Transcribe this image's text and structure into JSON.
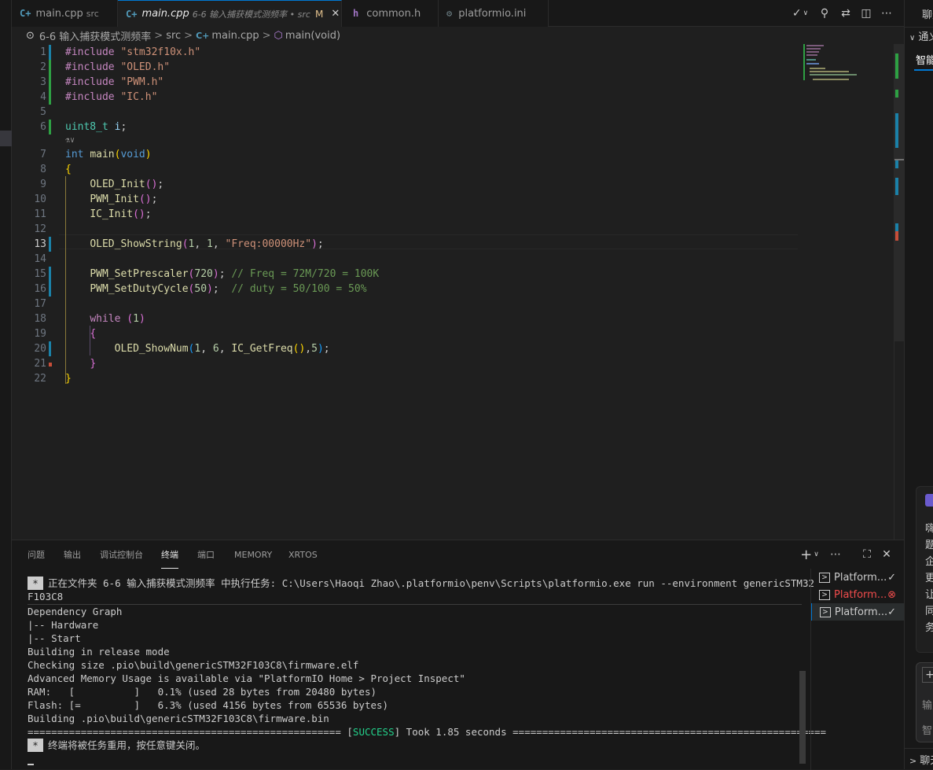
{
  "tabs": [
    {
      "icon": "C+",
      "label": "main.cpp",
      "dir": "src"
    },
    {
      "icon": "C+",
      "label": "main.cpp",
      "dir": "6-6 输入捕获模式测频率 • src",
      "status": "M",
      "close": "✕"
    },
    {
      "icon": "h",
      "label": "common.h"
    },
    {
      "icon": "⚙",
      "label": "platformio.ini"
    }
  ],
  "breadcrumb": {
    "folder": "6-6 输入捕获模式测频率",
    "src": "src",
    "file": "main.cpp",
    "symbol": "main(void)"
  },
  "code_lines": [
    {
      "n": "1",
      "tokens": [
        [
          "kwp",
          "#include"
        ],
        [
          "",
          " "
        ],
        [
          "str",
          "\"stm32f10x.h\""
        ]
      ]
    },
    {
      "n": "2",
      "tokens": [
        [
          "kwp",
          "#include"
        ],
        [
          "",
          " "
        ],
        [
          "str",
          "\"OLED.h\""
        ]
      ]
    },
    {
      "n": "3",
      "tokens": [
        [
          "kwp",
          "#include"
        ],
        [
          "",
          " "
        ],
        [
          "str",
          "\"PWM.h\""
        ]
      ]
    },
    {
      "n": "4",
      "tokens": [
        [
          "kwp",
          "#include"
        ],
        [
          "",
          " "
        ],
        [
          "str",
          "\"IC.h\""
        ]
      ]
    },
    {
      "n": "5",
      "tokens": []
    },
    {
      "n": "6",
      "tokens": [
        [
          "typ",
          "uint8_t"
        ],
        [
          "",
          " "
        ],
        [
          "var",
          "i"
        ],
        [
          "",
          ";"
        ]
      ]
    },
    {
      "n": "7",
      "tokens": [
        [
          "kw",
          "int"
        ],
        [
          "",
          " "
        ],
        [
          "fn",
          "main"
        ],
        [
          "br1",
          "("
        ],
        [
          "kw",
          "void"
        ],
        [
          "br1",
          ")"
        ]
      ]
    },
    {
      "n": "8",
      "tokens": [
        [
          "br1",
          "{"
        ]
      ]
    },
    {
      "n": "9",
      "tokens": [
        [
          "",
          "    "
        ],
        [
          "fn",
          "OLED_Init"
        ],
        [
          "br2",
          "()"
        ],
        [
          "",
          ";"
        ]
      ]
    },
    {
      "n": "10",
      "tokens": [
        [
          "",
          "    "
        ],
        [
          "fn",
          "PWM_Init"
        ],
        [
          "br2",
          "()"
        ],
        [
          "",
          ";"
        ]
      ]
    },
    {
      "n": "11",
      "tokens": [
        [
          "",
          "    "
        ],
        [
          "fn",
          "IC_Init"
        ],
        [
          "br2",
          "()"
        ],
        [
          "",
          ";"
        ]
      ]
    },
    {
      "n": "12",
      "tokens": []
    },
    {
      "n": "13",
      "tokens": [
        [
          "",
          "    "
        ],
        [
          "fn",
          "OLED_ShowString"
        ],
        [
          "br2",
          "("
        ],
        [
          "num",
          "1"
        ],
        [
          "",
          ", "
        ],
        [
          "num",
          "1"
        ],
        [
          "",
          ", "
        ],
        [
          "str",
          "\"Freq:00000Hz\""
        ],
        [
          "br2",
          ")"
        ],
        [
          "",
          ";"
        ]
      ]
    },
    {
      "n": "14",
      "tokens": []
    },
    {
      "n": "15",
      "tokens": [
        [
          "",
          "    "
        ],
        [
          "fn",
          "PWM_SetPrescaler"
        ],
        [
          "br2",
          "("
        ],
        [
          "num",
          "720"
        ],
        [
          "br2",
          ")"
        ],
        [
          "",
          "; "
        ],
        [
          "cmt",
          "// Freq = 72M/720 = 100K"
        ]
      ]
    },
    {
      "n": "16",
      "tokens": [
        [
          "",
          "    "
        ],
        [
          "fn",
          "PWM_SetDutyCycle"
        ],
        [
          "br2",
          "("
        ],
        [
          "num",
          "50"
        ],
        [
          "br2",
          ")"
        ],
        [
          "",
          ";  "
        ],
        [
          "cmt",
          "// duty = 50/100 = 50%"
        ]
      ]
    },
    {
      "n": "17",
      "tokens": []
    },
    {
      "n": "18",
      "tokens": [
        [
          "",
          "    "
        ],
        [
          "kwp",
          "while"
        ],
        [
          "",
          " "
        ],
        [
          "br2",
          "("
        ],
        [
          "num",
          "1"
        ],
        [
          "br2",
          ")"
        ]
      ]
    },
    {
      "n": "19",
      "tokens": [
        [
          "",
          "    "
        ],
        [
          "br2",
          "{"
        ]
      ]
    },
    {
      "n": "20",
      "tokens": [
        [
          "",
          "        "
        ],
        [
          "fn",
          "OLED_ShowNum"
        ],
        [
          "br3",
          "("
        ],
        [
          "num",
          "1"
        ],
        [
          "",
          ", "
        ],
        [
          "num",
          "6"
        ],
        [
          "",
          ", "
        ],
        [
          "fn",
          "IC_GetFreq"
        ],
        [
          "br1",
          "()"
        ],
        [
          "",
          ","
        ],
        [
          "num",
          "5"
        ],
        [
          "br3",
          ")"
        ],
        [
          "",
          ";"
        ]
      ]
    },
    {
      "n": "21",
      "tokens": [
        [
          "",
          "    "
        ],
        [
          "br2",
          "}"
        ]
      ]
    },
    {
      "n": "22",
      "tokens": [
        [
          "br1",
          "}"
        ]
      ]
    }
  ],
  "inline_hint": "⚗∨",
  "panel_tabs": [
    "问题",
    "输出",
    "调试控制台",
    "终端",
    "端口",
    "MEMORY",
    "XRTOS"
  ],
  "terminal": {
    "task_line_1": "正在文件夹 6-6 输入捕获模式测频率 中执行任务: C:\\Users\\Haoqi Zhao\\.platformio\\penv\\Scripts\\platformio.exe run --environment genericSTM32",
    "task_line_2": "F103C8",
    "lines": [
      "Dependency Graph",
      "|-- Hardware",
      "|-- Start",
      "Building in release mode",
      "Checking size .pio\\build\\genericSTM32F103C8\\firmware.elf",
      "Advanced Memory Usage is available via \"PlatformIO Home > Project Inspect\"",
      "RAM:   [          ]   0.1% (used 28 bytes from 20480 bytes)",
      "Flash: [=         ]   6.3% (used 4156 bytes from 65536 bytes)",
      "Building .pio\\build\\genericSTM32F103C8\\firmware.bin"
    ],
    "rule_left": "=====================================================",
    "success": "SUCCESS",
    "took": "Took 1.85 seconds",
    "rule_right": "=====================================================",
    "reuse_msg": "终端将被任务重用，按任意键关闭。"
  },
  "terminal_list": [
    {
      "label": "Platform...",
      "status": "✓",
      "color": "#cccccc"
    },
    {
      "label": "Platform...",
      "status": "⊗",
      "color": "#f14c4c"
    },
    {
      "label": "Platform...",
      "status": "✓",
      "color": "#cccccc"
    }
  ],
  "right_panel": {
    "title": "聊天",
    "section": "通义",
    "tab": "智能",
    "lines": [
      "嗨",
      "题",
      "企",
      "更",
      "让",
      "同",
      "务"
    ],
    "input_1": "输入",
    "input_2": "智能",
    "footer": "聊天"
  },
  "colors": {
    "accent": "#0078d4",
    "added": "#2ea043",
    "modified": "#0c7d9d",
    "deleted": "#f14c4c"
  }
}
